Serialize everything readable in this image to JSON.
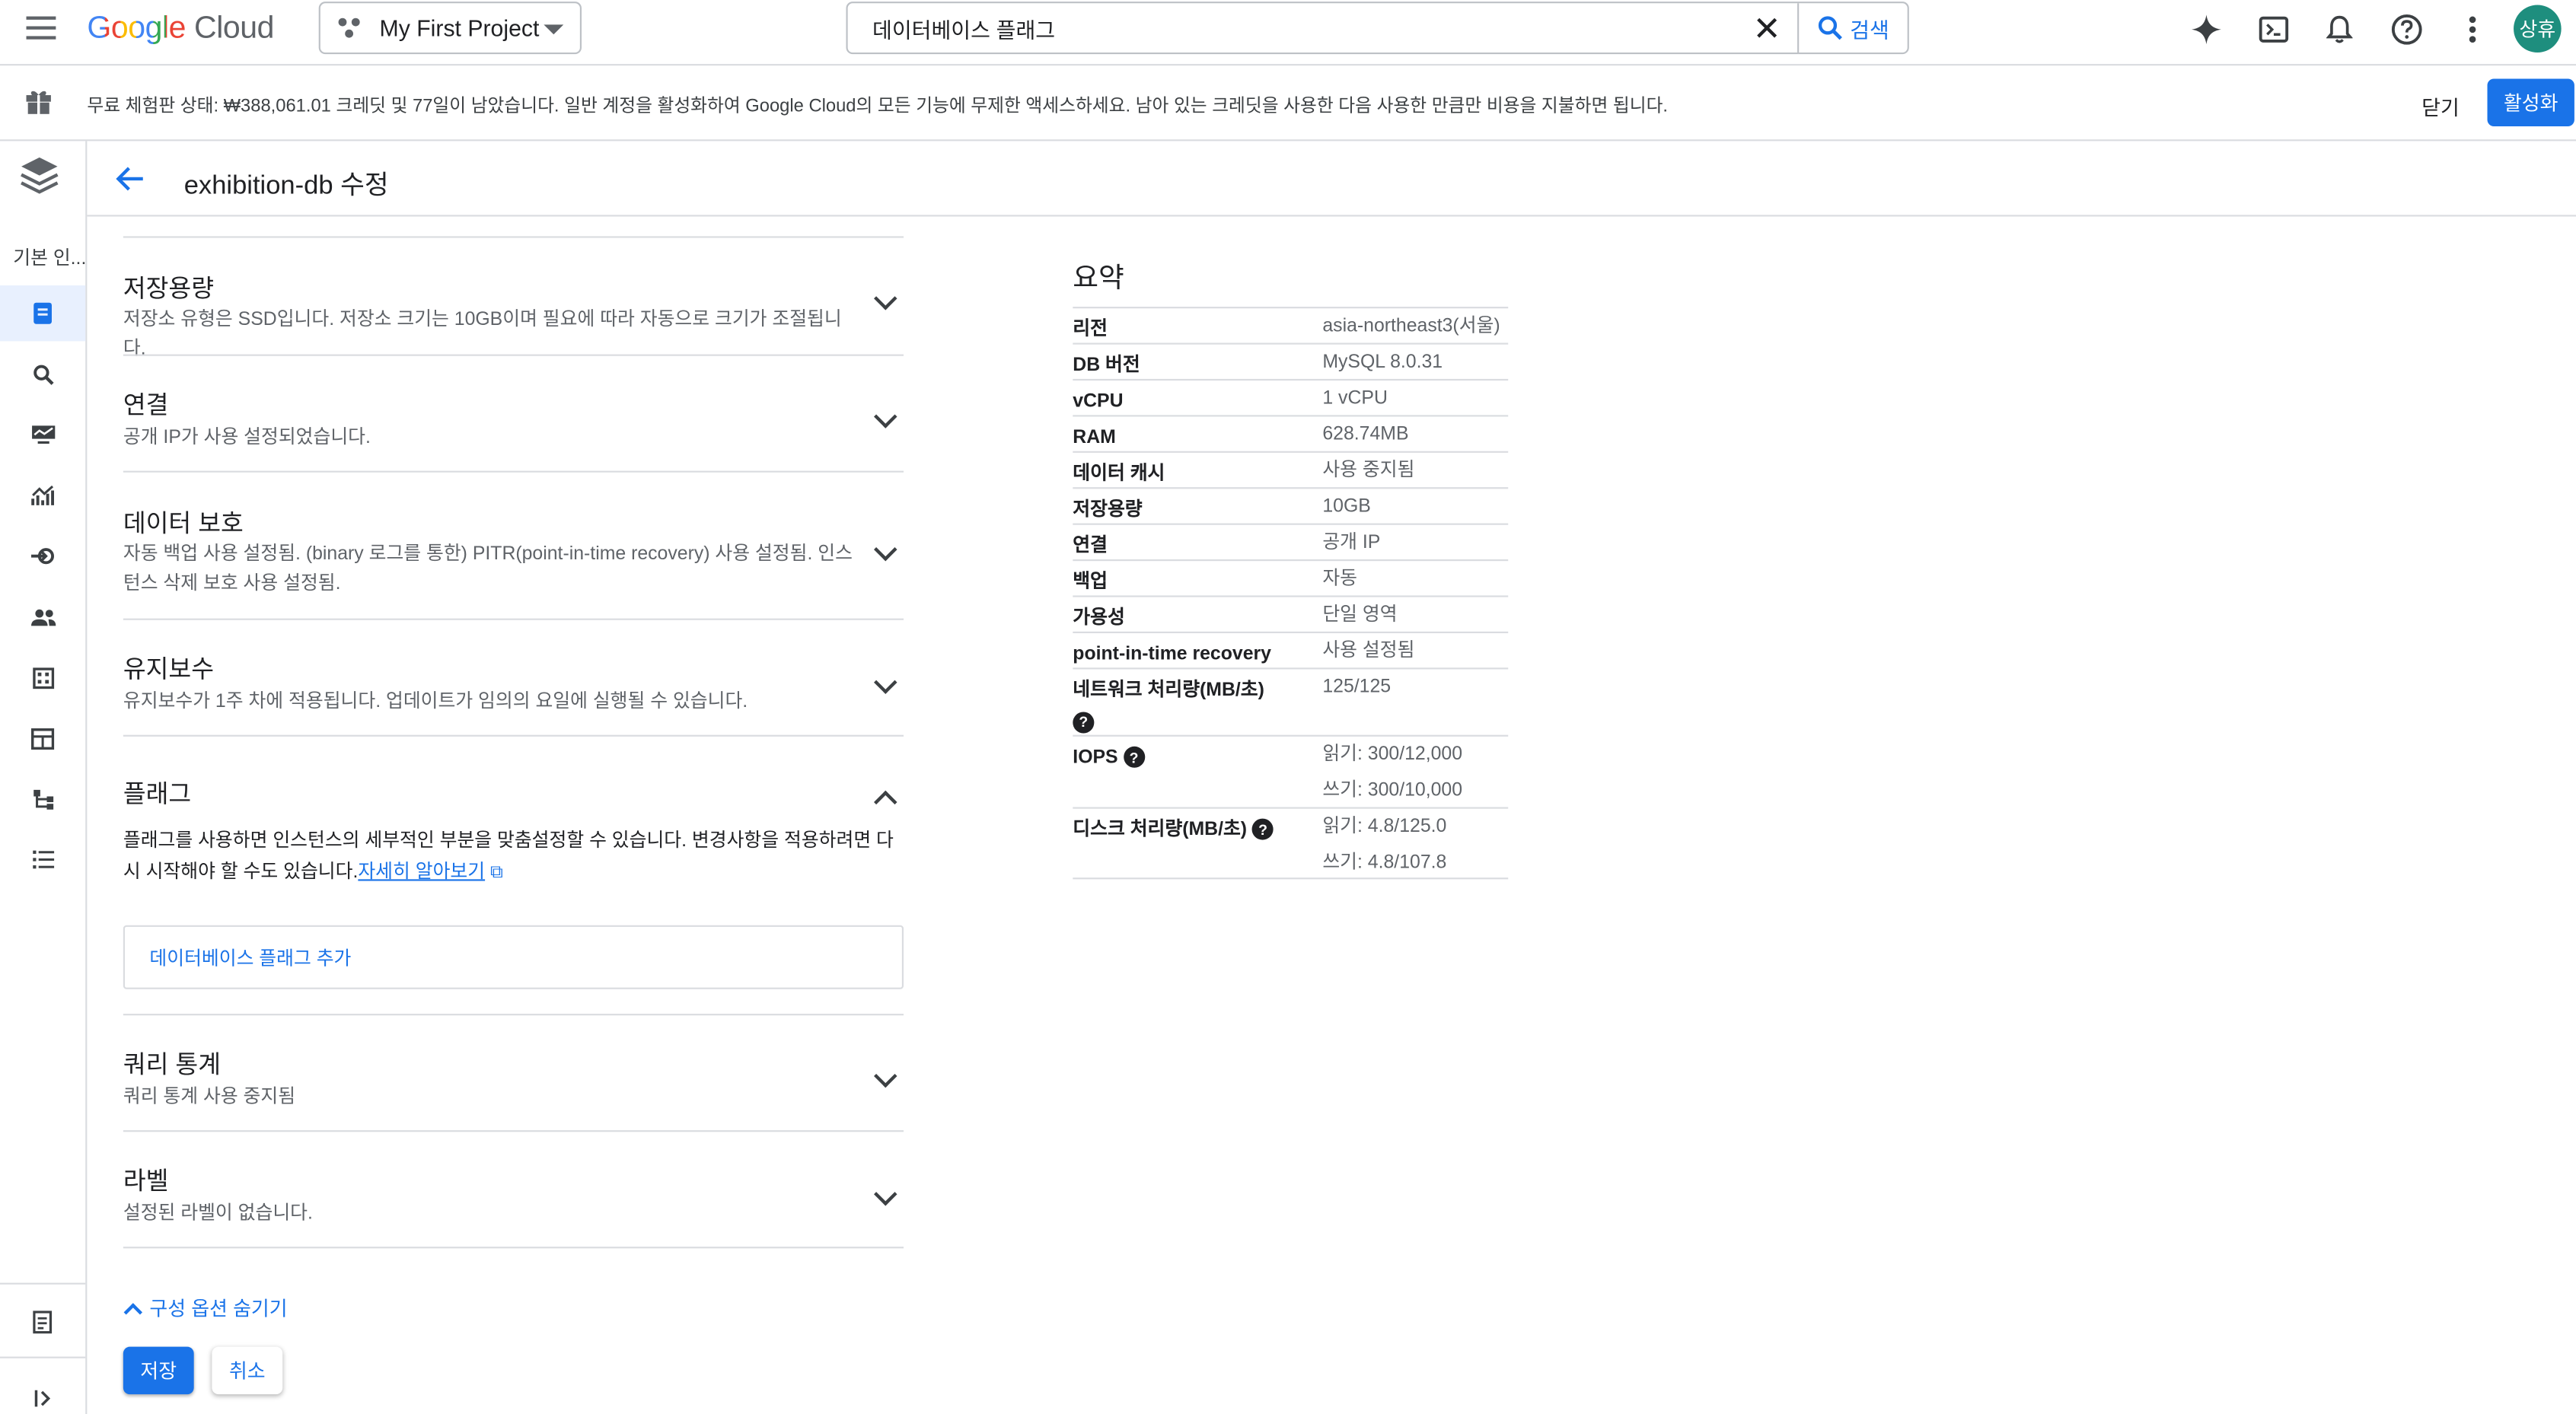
{
  "topbar": {
    "logo_google": "Google",
    "logo_cloud": "Cloud",
    "project": "My First Project",
    "search_value": "데이터베이스 플래그",
    "search_button": "검색",
    "avatar_text": "상휴"
  },
  "banner": {
    "message": "무료 체험판 상태: ₩388,061.01 크레딧 및 77일이 남았습니다. 일반 계정을 활성화하여 Google Cloud의 모든 기능에 무제한 액세스하세요. 남아 있는 크레딧을 사용한 다음 사용한 만큼만 비용을 지불하면 됩니다.",
    "close_label": "닫기",
    "activate_label": "활성화"
  },
  "rail": {
    "label": "기본 인..."
  },
  "page": {
    "title": "exhibition-db 수정"
  },
  "sections": [
    {
      "title": "저장용량",
      "desc": "저장소 유형은 SSD입니다. 저장소 크기는 10GB이며 필요에 따라 자동으로 크기가 조절됩니다."
    },
    {
      "title": "연결",
      "desc": "공개 IP가 사용 설정되었습니다."
    },
    {
      "title": "데이터 보호",
      "desc": "자동 백업 사용 설정됨. (binary 로그를 통한) PITR(point-in-time recovery) 사용 설정됨. 인스턴스 삭제 보호 사용 설정됨."
    },
    {
      "title": "유지보수",
      "desc": "유지보수가 1주 차에 적용됩니다. 업데이트가 임의의 요일에 실행될 수 있습니다."
    },
    {
      "title": "플래그",
      "desc": "플래그를 사용하면 인스턴스의 세부적인 부분을 맞춤설정할 수 있습니다. 변경사항을 적용하려면 다시 시작해야 할 수도 있습니다.",
      "link": "자세히 알아보기",
      "add_button": "데이터베이스 플래그 추가"
    },
    {
      "title": "쿼리 통계",
      "desc": "쿼리 통계 사용 중지됨"
    },
    {
      "title": "라벨",
      "desc": "설정된 라벨이 없습니다."
    }
  ],
  "actions": {
    "hide_options": "구성 옵션 숨기기",
    "save": "저장",
    "cancel": "취소"
  },
  "summary": {
    "title": "요약",
    "rows": [
      {
        "k": "리전",
        "v": "asia-northeast3(서울)"
      },
      {
        "k": "DB 버전",
        "v": "MySQL 8.0.31"
      },
      {
        "k": "vCPU",
        "v": "1 vCPU"
      },
      {
        "k": "RAM",
        "v": "628.74MB"
      },
      {
        "k": "데이터 캐시",
        "v": "사용 중지됨"
      },
      {
        "k": "저장용량",
        "v": "10GB"
      },
      {
        "k": "연결",
        "v": "공개 IP"
      },
      {
        "k": "백업",
        "v": "자동"
      },
      {
        "k": "가용성",
        "v": "단일 영역"
      },
      {
        "k": "point-in-time recovery",
        "v": "사용 설정됨"
      },
      {
        "k": "네트워크 처리량(MB/초)",
        "v": "125/125"
      },
      {
        "k": "IOPS",
        "v": "읽기: 300/12,000",
        "v2": "쓰기: 300/10,000"
      },
      {
        "k": "디스크 처리량(MB/초)",
        "v": "읽기: 4.8/125.0",
        "v2": "쓰기: 4.8/107.8"
      }
    ]
  },
  "icons": {
    "help_glyph": "?",
    "external_link_glyph": "⧉"
  }
}
